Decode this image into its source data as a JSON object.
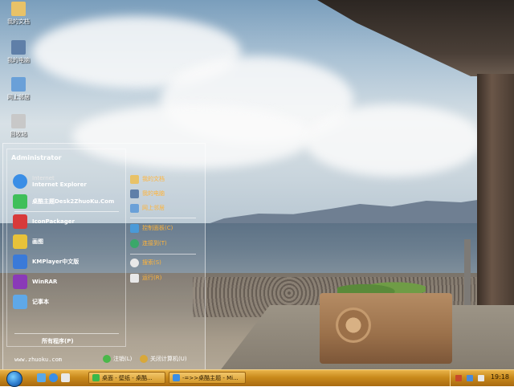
{
  "desktop": {
    "icons": [
      {
        "label": "我的文档",
        "icon": "my-documents-icon",
        "color": "#e8c268"
      },
      {
        "label": "我的电脑",
        "icon": "my-computer-icon",
        "color": "#5f7fa8"
      },
      {
        "label": "网上邻居",
        "icon": "network-places-icon",
        "color": "#6aa0d8"
      },
      {
        "label": "回收站",
        "icon": "recycle-bin-icon",
        "color": "#c8c8c8"
      }
    ]
  },
  "start_menu": {
    "user": "Administrator",
    "pinned": [
      {
        "label": "Internet Explorer",
        "sublabel": "Internet",
        "icon": "ie-icon",
        "color": "#3a8ee6"
      },
      {
        "label": "桌酷主题Desk2ZhuoKu.Com",
        "icon": "theme-icon",
        "color": "#3fbf5a"
      }
    ],
    "recent": [
      {
        "label": "IconPackager",
        "icon": "iconpackager-icon",
        "color": "#d83a3a"
      },
      {
        "label": "画图",
        "icon": "paint-icon",
        "color": "#e8c23a"
      },
      {
        "label": "KMPlayer中文版",
        "icon": "kmplayer-icon",
        "color": "#3a7ad8"
      },
      {
        "label": "WinRAR",
        "icon": "winrar-icon",
        "color": "#8a3ab8"
      },
      {
        "label": "记事本",
        "icon": "notepad-icon",
        "color": "#5fa8e8"
      }
    ],
    "all_programs": "所有程序(P)",
    "places": [
      {
        "label": "我的文档",
        "icon": "my-documents-icon",
        "color": "#e8c268"
      },
      {
        "label": "我的电脑",
        "icon": "my-computer-icon",
        "color": "#5f7fa8"
      },
      {
        "label": "网上邻居",
        "icon": "network-places-icon",
        "color": "#6aa0d8"
      }
    ],
    "settings": [
      {
        "label": "控制面板(C)",
        "icon": "control-panel-icon",
        "color": "#4a9ad8"
      },
      {
        "label": "连接到(T)",
        "icon": "connect-to-icon",
        "color": "#3aa86a"
      }
    ],
    "tools": [
      {
        "label": "搜索(S)",
        "icon": "search-icon",
        "color": "#e8e8e8"
      },
      {
        "label": "运行(R)",
        "icon": "run-icon",
        "color": "#e8e8e8"
      }
    ],
    "footer": {
      "url": "www.zhuoku.com",
      "logoff": "注销(L)",
      "shutdown": "关闭计算机(U)",
      "logoff_color": "#4ab84a",
      "shutdown_color": "#d8a83a"
    }
  },
  "taskbar": {
    "tasks": [
      {
        "label": "桌面 - 壁纸 - 桌酷...",
        "icon": "folder-icon",
        "color": "#3ab84a"
      },
      {
        "label": "-=>>桌酷主题 - Mi...",
        "icon": "ie-icon",
        "color": "#3a8ee6"
      }
    ],
    "quick_launch": [
      {
        "icon": "show-desktop-icon",
        "color": "#5aa8e8"
      },
      {
        "icon": "ie-icon",
        "color": "#3a8ee6"
      },
      {
        "icon": "media-player-icon",
        "color": "#e8e8e8"
      }
    ],
    "tray_icons": [
      {
        "icon": "tray-user-icon",
        "color": "#c84a2a"
      },
      {
        "icon": "tray-network-icon",
        "color": "#4a8ad8"
      },
      {
        "icon": "tray-volume-icon",
        "color": "#e8e8e8"
      }
    ],
    "clock": "19:18"
  }
}
